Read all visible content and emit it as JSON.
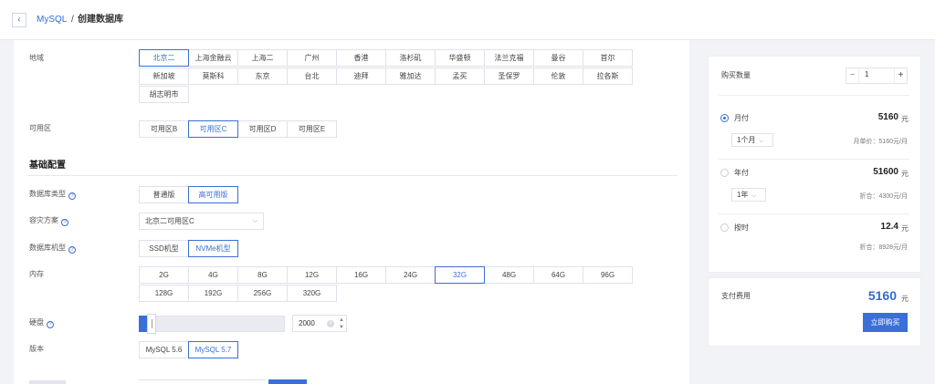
{
  "header": {
    "back_icon": "‹",
    "breadcrumb_link": "MySQL",
    "breadcrumb_sep": "/",
    "breadcrumb_current": "创建数据库"
  },
  "form": {
    "region_label": "地域",
    "regions": [
      "北京二",
      "上海金融云",
      "上海二",
      "广州",
      "香港",
      "洛杉矶",
      "华盛顿",
      "法兰克福",
      "曼谷",
      "首尔",
      "新加坡",
      "莫斯科",
      "东京",
      "台北",
      "迪拜",
      "雅加达",
      "孟买",
      "圣保罗",
      "伦敦",
      "拉各斯",
      "胡志明市"
    ],
    "region_selected": 0,
    "zone_label": "可用区",
    "zones": [
      "可用区B",
      "可用区C",
      "可用区D",
      "可用区E"
    ],
    "zone_selected": 1,
    "section_title": "基础配置",
    "dbtype_label": "数据库类型",
    "dbtypes": [
      "普通版",
      "高可用版"
    ],
    "dbtype_selected": 1,
    "dr_label": "容灾方案",
    "dr_value": "北京二可用区C",
    "machine_label": "数据库机型",
    "machines": [
      "SSD机型",
      "NVMe机型"
    ],
    "machine_selected": 1,
    "memory_label": "内存",
    "memories": [
      "2G",
      "4G",
      "8G",
      "12G",
      "16G",
      "24G",
      "32G",
      "48G",
      "64G",
      "96G",
      "128G",
      "192G",
      "256G",
      "320G"
    ],
    "memory_selected": 6,
    "disk_label": "硬盘",
    "disk_value": "2000",
    "version_label": "版本",
    "versions": [
      "MySQL 5.6",
      "MySQL 5.7"
    ],
    "version_selected": 1,
    "help_icon": "?"
  },
  "sidebar": {
    "qty_label": "购买数量",
    "qty_value": "1",
    "qty_minus": "−",
    "qty_plus": "+",
    "monthly_label": "月付",
    "monthly_price": "5160",
    "monthly_unit": "元",
    "monthly_period": "1个月",
    "monthly_sub": "月单价：5160元/月",
    "yearly_label": "年付",
    "yearly_price": "51600",
    "yearly_unit": "元",
    "yearly_period": "1年",
    "yearly_sub": "折合：4300元/月",
    "hourly_label": "按时",
    "hourly_price": "12.4",
    "hourly_unit": "元",
    "hourly_sub": "折合：8928元/月",
    "pay_label": "支付费用",
    "pay_price": "5160",
    "pay_unit": "元",
    "buy_label": "立即购买",
    "selected_plan": "monthly"
  }
}
